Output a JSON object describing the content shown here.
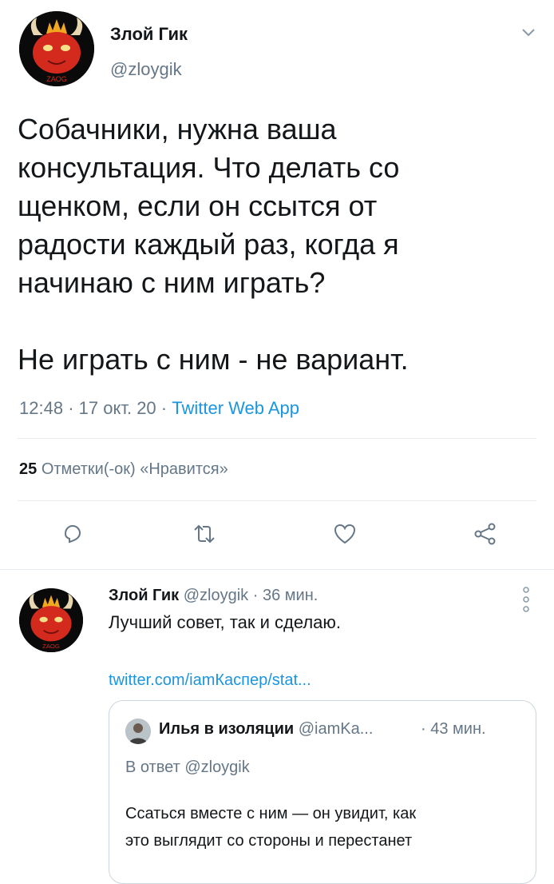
{
  "tweet": {
    "author_name": "Злой Гик",
    "author_handle": "@zloygik",
    "avatar_label": "ZAOG",
    "text_lines": [
      "Собачники, нужна ваша",
      "консультация. Что делать со",
      "щенком, если он ссытся от",
      "радости каждый раз, когда я",
      "начинаю с ним играть?",
      "",
      "Не играть с ним - не вариант."
    ],
    "time": "12:48",
    "date": "17 окт. 20",
    "source": "Twitter Web App",
    "likes_count": "25",
    "likes_label": "Отметки(-ок) «Нравится»"
  },
  "actions": [
    "reply-icon",
    "retweet-icon",
    "like-icon",
    "share-icon"
  ],
  "reply": {
    "author_name": "Злой Гик",
    "author_handle": "@zloygik",
    "time_ago": "36 мин.",
    "text": "Лучший совет, так и сделаю.",
    "link": "twitter.com/iamКаспер/stat...",
    "quoted": {
      "author_name": "Илья в изоляции",
      "author_handle": "@iamKa...",
      "time_ago": "43 мин.",
      "reply_to": "В ответ @zloygik",
      "text_lines": [
        "Ссаться вместе с ним — он увидит, как",
        "это выглядит со стороны и перестанет"
      ]
    }
  },
  "colors": {
    "accent": "#1b95e0",
    "muted": "#657786",
    "divider": "#e6ecf0",
    "avatar_red": "#d42a1e"
  }
}
